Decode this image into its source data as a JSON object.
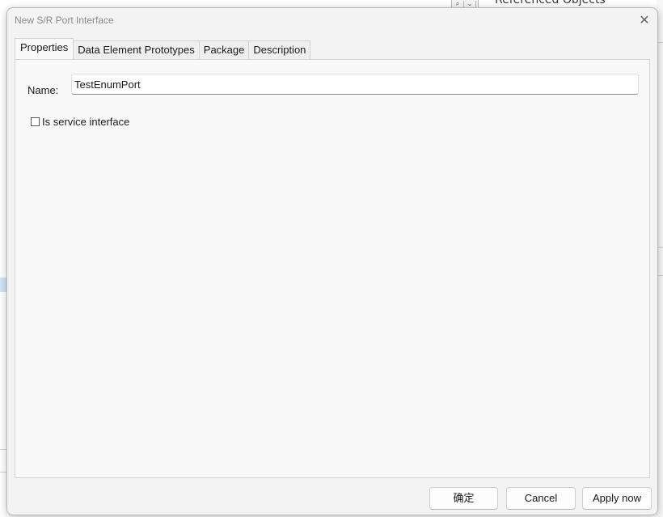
{
  "dialog": {
    "title": "New S/R Port Interface",
    "close_glyph": "✕",
    "tabs": [
      {
        "label": "Properties",
        "active": true
      },
      {
        "label": "Data Element Prototypes",
        "active": false
      },
      {
        "label": "Package",
        "active": false
      },
      {
        "label": "Description",
        "active": false
      }
    ],
    "properties": {
      "name_label": "Name:",
      "name_value": "TestEnumPort",
      "service_checkbox_label": "Is service interface",
      "service_checked": false
    },
    "buttons": {
      "ok_label": "确定",
      "cancel_label": "Cancel",
      "apply_label": "Apply now"
    }
  },
  "background": {
    "top_fragment_text": "Referenced Objects",
    "icons": [
      "search-icon",
      "chevron-down-icon"
    ]
  }
}
